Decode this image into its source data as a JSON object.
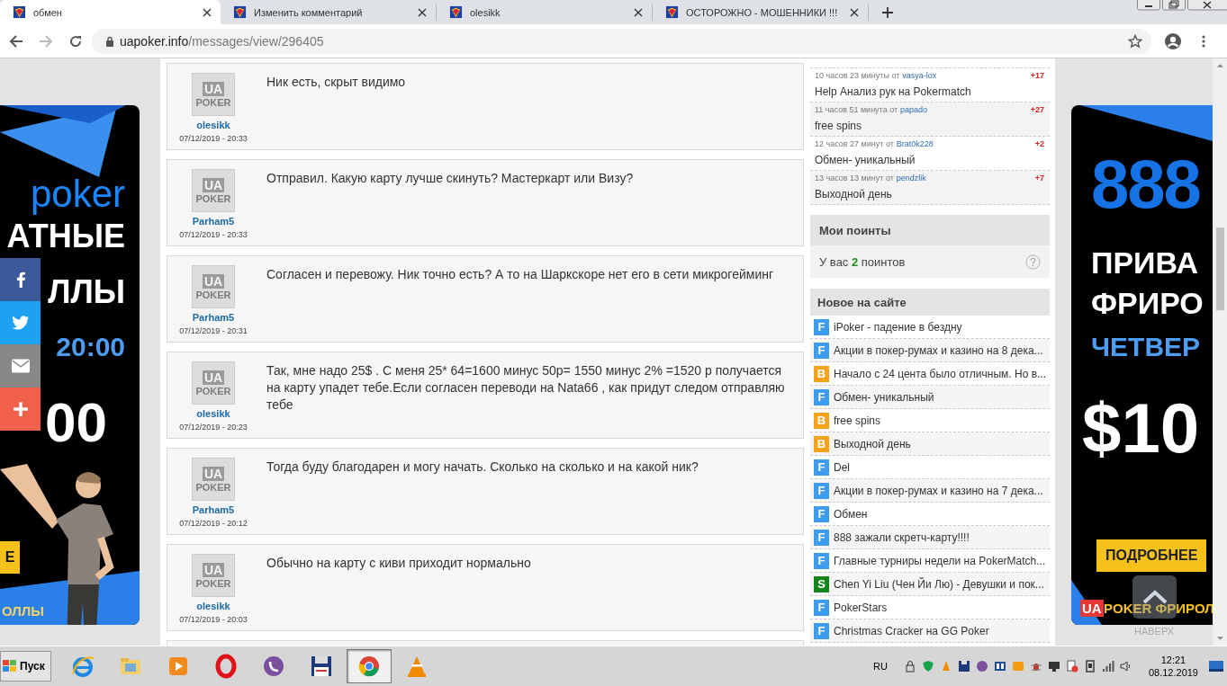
{
  "browser": {
    "tabs": [
      {
        "title": "обмен",
        "selected": true
      },
      {
        "title": "Изменить комментарий",
        "selected": false
      },
      {
        "title": "olesikk",
        "selected": false
      },
      {
        "title": "ОСТОРОЖНО - МОШЕННИКИ !!!",
        "selected": false
      }
    ],
    "url_host": "uapoker.info",
    "url_path": "/messages/view/296405"
  },
  "messages": [
    {
      "author": "olesikk",
      "avatar": [
        "UA",
        "POKER"
      ],
      "date": "07/12/2019 - 20:33",
      "text": "Ник есть, скрыт видимо"
    },
    {
      "author": "Parham5",
      "avatar": [
        "UA",
        "POKER"
      ],
      "date": "07/12/2019 - 20:33",
      "text": "Отправил. Какую карту лучше скинуть? Мастеркарт или Визу?"
    },
    {
      "author": "Parham5",
      "avatar": [
        "UA",
        "POKER"
      ],
      "date": "07/12/2019 - 20:31",
      "text": "Согласен и перевожу. Ник точно есть? А то на Шаркскоре нет его в сети микрогейминг"
    },
    {
      "author": "olesikk",
      "avatar": [
        "UA",
        "POKER"
      ],
      "date": "07/12/2019 - 20:23",
      "text": "Так, мне надо 25$ . С меня 25* 64=1600 минус 50р= 1550 минус 2% =1520 р получается на карту упадет тебе.Если согласен переводи на Nata66 , как придут следом отправляю тебе"
    },
    {
      "author": "Parham5",
      "avatar": [
        "UA",
        "POKER"
      ],
      "date": "07/12/2019 - 20:12",
      "text": "Тогда буду благодарен и могу начать. Сколько на сколько и на какой ник?"
    },
    {
      "author": "olesikk",
      "avatar": [
        "UA",
        "POKER"
      ],
      "date": "07/12/2019 - 20:03",
      "text": "Обычно на карту с киви приходит нормально"
    }
  ],
  "recent": [
    {
      "time": "10 часов 23 минуты от",
      "user": "vasya-lox",
      "score": "+17",
      "title": "Help Анализ рук на Pokermatch"
    },
    {
      "time": "11 часов 51 минута от",
      "user": "papado",
      "score": "+27",
      "title": "free spins"
    },
    {
      "time": "12 часов 27 минут от",
      "user": "Brat0k228",
      "score": "+2",
      "title": "Обмен- уникальный"
    },
    {
      "time": "13 часов 13 минут от",
      "user": "pendzlik",
      "score": "+7",
      "title": "Выходной день"
    }
  ],
  "points": {
    "title": "Мои поинты",
    "text": "У вас **2** поинтов"
  },
  "new_on_site": {
    "title": "Новое на сайте",
    "items": [
      {
        "badge": "F",
        "color": "#3d9bf0",
        "title": "iPoker - падение в бездну"
      },
      {
        "badge": "F",
        "color": "#3d9bf0",
        "title": "Акции в покер-румах и казино на 8 дека..."
      },
      {
        "badge": "B",
        "color": "#f7a21b",
        "title": "Начало с 24 цента было отличным. Но в..."
      },
      {
        "badge": "F",
        "color": "#3d9bf0",
        "title": "Обмен- уникальный"
      },
      {
        "badge": "B",
        "color": "#f7a21b",
        "title": "free spins"
      },
      {
        "badge": "B",
        "color": "#f7a21b",
        "title": "Выходной день"
      },
      {
        "badge": "F",
        "color": "#3d9bf0",
        "title": "Del"
      },
      {
        "badge": "F",
        "color": "#3d9bf0",
        "title": "Акции в покер-румах и казино на 7 дека..."
      },
      {
        "badge": "F",
        "color": "#3d9bf0",
        "title": "Обмен"
      },
      {
        "badge": "F",
        "color": "#3d9bf0",
        "title": "888 зажали скретч-карту!!!!"
      },
      {
        "badge": "F",
        "color": "#3d9bf0",
        "title": "Главные турниры недели на PokerMatch..."
      },
      {
        "badge": "S",
        "color": "#13861b",
        "title": "Chen Yi Liu (Чен Йи Лю) - Девушки и пок..."
      },
      {
        "badge": "F",
        "color": "#3d9bf0",
        "title": "PokerStars"
      },
      {
        "badge": "F",
        "color": "#3d9bf0",
        "title": "Christmas Cracker на GG Poker"
      }
    ]
  },
  "left_ad": {
    "brand": "poker",
    "line_1": "АТНЫЕ",
    "line_2": "ЛЛЫ",
    "time": "20:00",
    "amount": "00",
    "button": "Е",
    "footer": "ОЛЛЫ"
  },
  "right_ad": {
    "brand": "888",
    "line_1": "ПРИВА",
    "line_2": "ФРИРО",
    "day": "ЧЕТВЕР",
    "amount": "$10",
    "button": "ПОДРОБНЕЕ",
    "logo": "UA",
    "footer": "POKER ФРИРОЛ"
  },
  "scroll_top": "НАВЕРХ",
  "taskbar": {
    "start": "Пуск",
    "apps": [
      {
        "kind": "ie",
        "selected": false
      },
      {
        "kind": "explorer",
        "selected": false
      },
      {
        "kind": "player",
        "selected": false
      },
      {
        "kind": "opera",
        "selected": false
      },
      {
        "kind": "viber",
        "selected": false
      },
      {
        "kind": "floppy",
        "selected": false
      },
      {
        "kind": "chrome",
        "selected": true
      },
      {
        "kind": "vlc",
        "selected": false
      }
    ],
    "language": "RU",
    "time": "12:21",
    "date": "08.12.2019"
  }
}
